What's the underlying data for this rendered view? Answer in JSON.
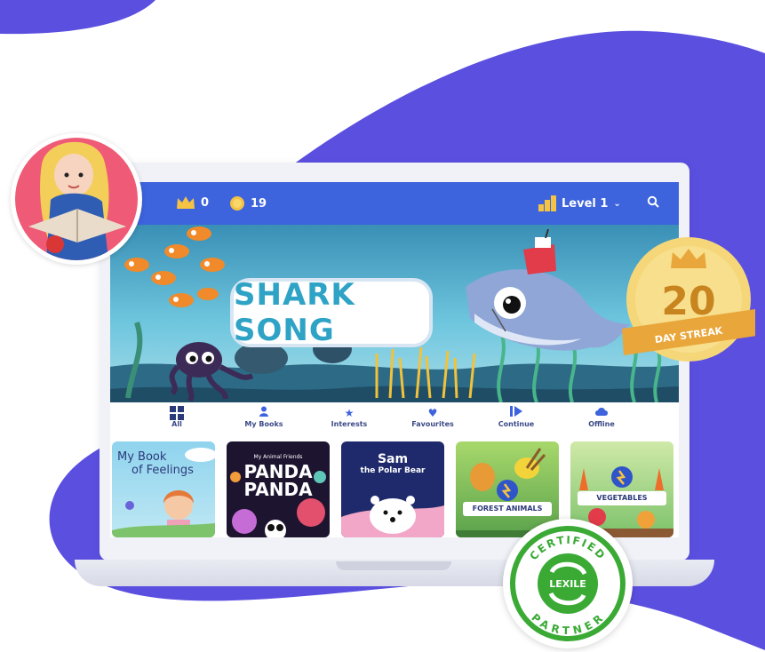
{
  "topbar": {
    "crowns": "0",
    "coins": "19",
    "level": "Level 1"
  },
  "banner": {
    "title": "SHARK SONG"
  },
  "tabs": [
    {
      "label": "All",
      "icon": "grid-icon"
    },
    {
      "label": "My Books",
      "icon": "person-icon"
    },
    {
      "label": "Interests",
      "icon": "star-icon"
    },
    {
      "label": "Favourites",
      "icon": "heart-icon"
    },
    {
      "label": "Continue",
      "icon": "play-icon"
    },
    {
      "label": "Offline",
      "icon": "cloud-icon"
    }
  ],
  "books": [
    {
      "title_line1": "My Book",
      "title_line2": "of Feelings"
    },
    {
      "top_text": "My Animal Friends",
      "title_line1": "PANDA",
      "title_line2": "PANDA"
    },
    {
      "title_line1": "Sam",
      "title_line2": "the Polar Bear"
    },
    {
      "title_line1": "FOREST ANIMALS"
    },
    {
      "title_line1": "VEGETABLES"
    }
  ],
  "streak": {
    "number": "20",
    "label": "DAY STREAK"
  },
  "lexile": {
    "top": "CERTIFIED",
    "center": "LEXILE",
    "bottom": "PARTNER"
  },
  "colors": {
    "purple": "#5b4fe0",
    "topbar_blue": "#3d63dd",
    "gold": "#f5c343"
  }
}
